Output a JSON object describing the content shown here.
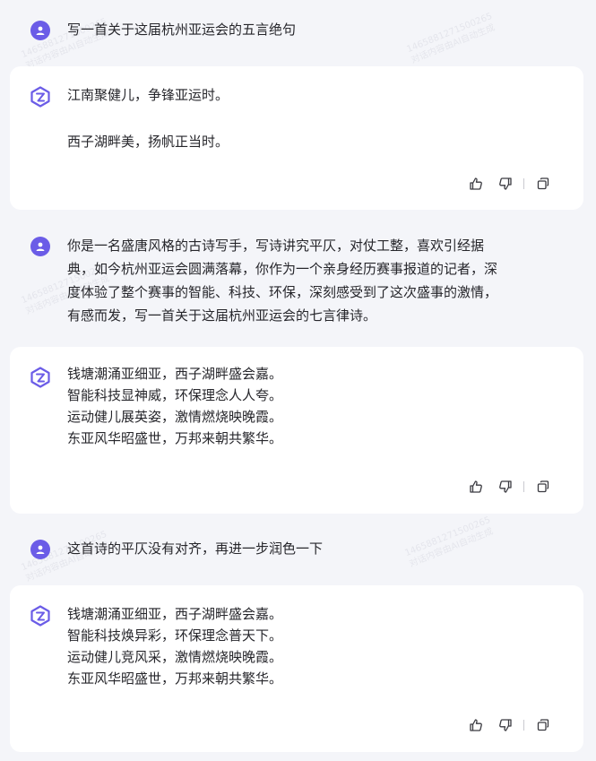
{
  "messages": [
    {
      "role": "user",
      "text": "写一首关于这届杭州亚运会的五言绝句"
    },
    {
      "role": "assistant",
      "text": "江南聚健儿，争锋亚运时。\n\n西子湖畔美，扬帆正当时。"
    },
    {
      "role": "user",
      "text": "你是一名盛唐风格的古诗写手，写诗讲究平仄，对仗工整，喜欢引经据\n典，如今杭州亚运会圆满落幕，你作为一个亲身经历赛事报道的记者，深\n度体验了整个赛事的智能、科技、环保，深刻感受到了这次盛事的激情，\n有感而发，写一首关于这届杭州亚运会的七言律诗。"
    },
    {
      "role": "assistant",
      "text": "钱塘潮涌亚细亚，西子湖畔盛会嘉。\n智能科技显神威，环保理念人人夸。\n运动健儿展英姿，激情燃烧映晚霞。\n东亚风华昭盛世，万邦来朝共繁华。"
    },
    {
      "role": "user",
      "text": "这首诗的平仄没有对齐，再进一步润色一下"
    },
    {
      "role": "assistant",
      "text": "钱塘潮涌亚细亚，西子湖畔盛会嘉。\n智能科技焕异彩，环保理念普天下。\n运动健儿竞风采，激情燃烧映晚霞。\n东亚风华昭盛世，万邦来朝共繁华。"
    }
  ],
  "watermark": "1465881271500265\n对话内容由AI自动生成",
  "icons": {
    "user_avatar": "user-icon",
    "bot_avatar": "assistant-logo-icon",
    "like": "thumbs-up-icon",
    "dislike": "thumbs-down-icon",
    "copy": "copy-icon"
  },
  "colors": {
    "accent": "#6b5ce7",
    "background": "#f4f5f9",
    "card": "#ffffff"
  }
}
